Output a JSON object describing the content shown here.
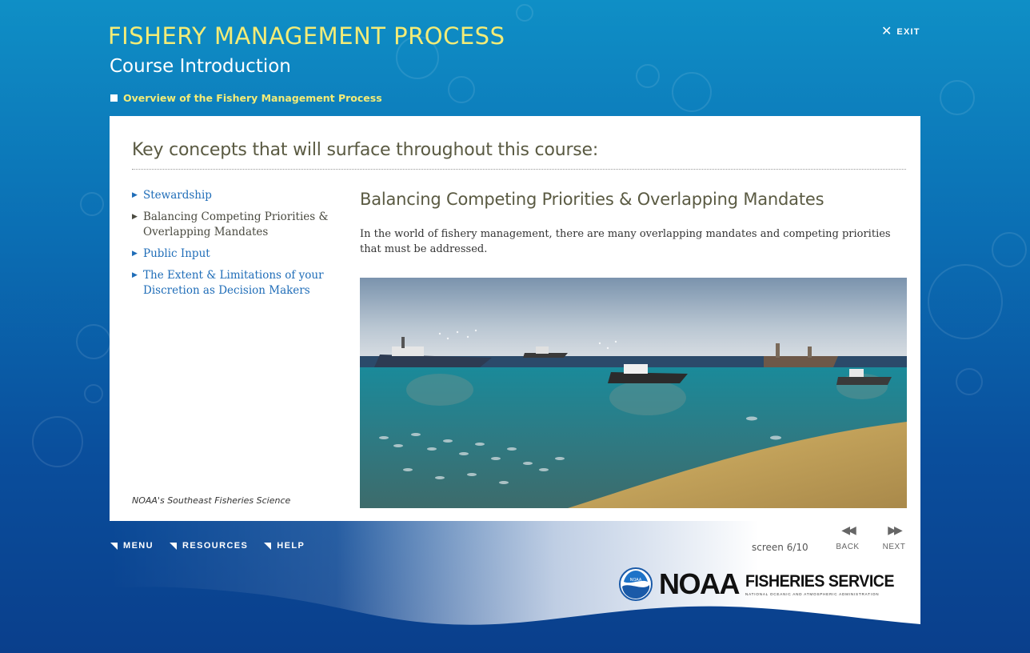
{
  "header": {
    "app_title": "FISHERY MANAGEMENT PROCESS",
    "subtitle": "Course Introduction",
    "breadcrumb": "Overview of the Fishery Management Process",
    "exit_label": "EXIT"
  },
  "main": {
    "heading": "Key concepts that will surface throughout this course:",
    "concepts": [
      {
        "label": "Stewardship",
        "active": false
      },
      {
        "label": "Balancing Competing Priorities & Overlapping Mandates",
        "active": true
      },
      {
        "label": "Public Input",
        "active": false
      },
      {
        "label": "The Extent & Limitations of your Discretion as Decision Makers",
        "active": false
      }
    ],
    "section_title": "Balancing Competing Priorities & Overlapping Mandates",
    "body_text": "In the world of fishery management, there are many overlapping mandates and competing priorities that must be addressed.",
    "credit": "NOAA's Southeast Fisheries Science"
  },
  "footer": {
    "nav": [
      "MENU",
      "RESOURCES",
      "HELP"
    ],
    "screen_counter": "screen 6/10",
    "back_label": "BACK",
    "next_label": "NEXT"
  },
  "logo": {
    "emblem_text": "NOAA",
    "word": "NOAA",
    "title": "FISHERIES SERVICE",
    "subtitle": "NATIONAL OCEANIC AND ATMOSPHERIC ADMINISTRATION"
  },
  "colors": {
    "title_yellow": "#f3ec77",
    "link_blue": "#1f6db8",
    "background_blue": "#0a4e9c"
  },
  "icons": {
    "exit": "close-icon",
    "list_marker": "triangle-right-icon",
    "back": "double-chevron-left-icon",
    "next": "double-chevron-right-icon"
  }
}
